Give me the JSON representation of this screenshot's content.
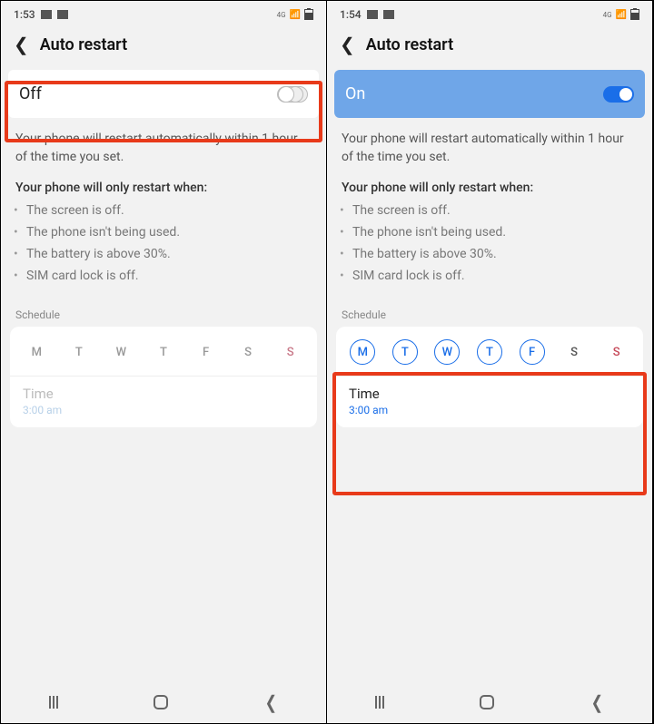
{
  "left": {
    "status": {
      "time": "1:53",
      "network": "4G"
    },
    "header": {
      "title": "Auto restart"
    },
    "toggle": {
      "label": "Off",
      "enabled": false
    },
    "description": "Your phone will restart automatically within 1 hour of the time you set.",
    "conditions_title": "Your phone will only restart when:",
    "conditions": [
      "The screen is off.",
      "The phone isn't being used.",
      "The battery is above 30%.",
      "SIM card lock is off."
    ],
    "schedule_label": "Schedule",
    "days": [
      {
        "label": "M",
        "selected": false
      },
      {
        "label": "T",
        "selected": false
      },
      {
        "label": "W",
        "selected": false
      },
      {
        "label": "T",
        "selected": false
      },
      {
        "label": "F",
        "selected": false
      },
      {
        "label": "S",
        "selected": false,
        "sat": true
      },
      {
        "label": "S",
        "selected": false,
        "sun": true
      }
    ],
    "time": {
      "label": "Time",
      "value": "3:00 am"
    }
  },
  "right": {
    "status": {
      "time": "1:54",
      "network": "4G"
    },
    "header": {
      "title": "Auto restart"
    },
    "toggle": {
      "label": "On",
      "enabled": true
    },
    "description": "Your phone will restart automatically within 1 hour of the time you set.",
    "conditions_title": "Your phone will only restart when:",
    "conditions": [
      "The screen is off.",
      "The phone isn't being used.",
      "The battery is above 30%.",
      "SIM card lock is off."
    ],
    "schedule_label": "Schedule",
    "days": [
      {
        "label": "M",
        "selected": true
      },
      {
        "label": "T",
        "selected": true
      },
      {
        "label": "W",
        "selected": true
      },
      {
        "label": "T",
        "selected": true
      },
      {
        "label": "F",
        "selected": true
      },
      {
        "label": "S",
        "selected": false,
        "sat": true
      },
      {
        "label": "S",
        "selected": false,
        "sun": true
      }
    ],
    "time": {
      "label": "Time",
      "value": "3:00 am"
    }
  }
}
